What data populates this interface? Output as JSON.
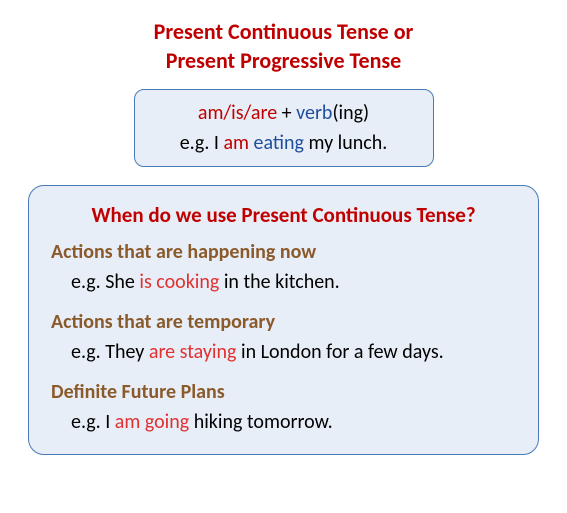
{
  "title": {
    "line1": "Present Continuous Tense or",
    "line2": "Present Progressive Tense"
  },
  "formula": {
    "aux": "am/is/are",
    "plus": " + ",
    "verb": "verb",
    "ing_open": "(",
    "ing": "ing",
    "ing_close": ")",
    "eg_prefix": "e.g. I ",
    "eg_aux": "am",
    "eg_mid": " ",
    "eg_verb": "eating",
    "eg_rest": " my lunch."
  },
  "usage": {
    "question": "When do we use Present Continuous Tense?",
    "sections": [
      {
        "heading": "Actions that are happening now",
        "eg_prefix": "e.g. She ",
        "eg_hl": "is cooking",
        "eg_rest": " in the kitchen."
      },
      {
        "heading": "Actions that are temporary",
        "eg_prefix": "e.g. They ",
        "eg_hl": "are staying",
        "eg_rest": " in London for a few days."
      },
      {
        "heading": "Definite Future Plans",
        "eg_prefix": "e.g. I ",
        "eg_hl": "am going",
        "eg_rest": " hiking tomorrow."
      }
    ]
  }
}
